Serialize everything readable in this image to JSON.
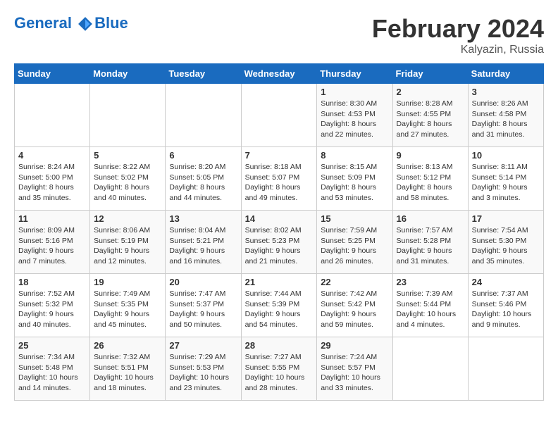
{
  "header": {
    "logo_line1": "General",
    "logo_line2": "Blue",
    "title": "February 2024",
    "subtitle": "Kalyazin, Russia"
  },
  "days_of_week": [
    "Sunday",
    "Monday",
    "Tuesday",
    "Wednesday",
    "Thursday",
    "Friday",
    "Saturday"
  ],
  "weeks": [
    [
      {
        "day": "",
        "info": ""
      },
      {
        "day": "",
        "info": ""
      },
      {
        "day": "",
        "info": ""
      },
      {
        "day": "",
        "info": ""
      },
      {
        "day": "1",
        "info": "Sunrise: 8:30 AM\nSunset: 4:53 PM\nDaylight: 8 hours\nand 22 minutes."
      },
      {
        "day": "2",
        "info": "Sunrise: 8:28 AM\nSunset: 4:55 PM\nDaylight: 8 hours\nand 27 minutes."
      },
      {
        "day": "3",
        "info": "Sunrise: 8:26 AM\nSunset: 4:58 PM\nDaylight: 8 hours\nand 31 minutes."
      }
    ],
    [
      {
        "day": "4",
        "info": "Sunrise: 8:24 AM\nSunset: 5:00 PM\nDaylight: 8 hours\nand 35 minutes."
      },
      {
        "day": "5",
        "info": "Sunrise: 8:22 AM\nSunset: 5:02 PM\nDaylight: 8 hours\nand 40 minutes."
      },
      {
        "day": "6",
        "info": "Sunrise: 8:20 AM\nSunset: 5:05 PM\nDaylight: 8 hours\nand 44 minutes."
      },
      {
        "day": "7",
        "info": "Sunrise: 8:18 AM\nSunset: 5:07 PM\nDaylight: 8 hours\nand 49 minutes."
      },
      {
        "day": "8",
        "info": "Sunrise: 8:15 AM\nSunset: 5:09 PM\nDaylight: 8 hours\nand 53 minutes."
      },
      {
        "day": "9",
        "info": "Sunrise: 8:13 AM\nSunset: 5:12 PM\nDaylight: 8 hours\nand 58 minutes."
      },
      {
        "day": "10",
        "info": "Sunrise: 8:11 AM\nSunset: 5:14 PM\nDaylight: 9 hours\nand 3 minutes."
      }
    ],
    [
      {
        "day": "11",
        "info": "Sunrise: 8:09 AM\nSunset: 5:16 PM\nDaylight: 9 hours\nand 7 minutes."
      },
      {
        "day": "12",
        "info": "Sunrise: 8:06 AM\nSunset: 5:19 PM\nDaylight: 9 hours\nand 12 minutes."
      },
      {
        "day": "13",
        "info": "Sunrise: 8:04 AM\nSunset: 5:21 PM\nDaylight: 9 hours\nand 16 minutes."
      },
      {
        "day": "14",
        "info": "Sunrise: 8:02 AM\nSunset: 5:23 PM\nDaylight: 9 hours\nand 21 minutes."
      },
      {
        "day": "15",
        "info": "Sunrise: 7:59 AM\nSunset: 5:25 PM\nDaylight: 9 hours\nand 26 minutes."
      },
      {
        "day": "16",
        "info": "Sunrise: 7:57 AM\nSunset: 5:28 PM\nDaylight: 9 hours\nand 31 minutes."
      },
      {
        "day": "17",
        "info": "Sunrise: 7:54 AM\nSunset: 5:30 PM\nDaylight: 9 hours\nand 35 minutes."
      }
    ],
    [
      {
        "day": "18",
        "info": "Sunrise: 7:52 AM\nSunset: 5:32 PM\nDaylight: 9 hours\nand 40 minutes."
      },
      {
        "day": "19",
        "info": "Sunrise: 7:49 AM\nSunset: 5:35 PM\nDaylight: 9 hours\nand 45 minutes."
      },
      {
        "day": "20",
        "info": "Sunrise: 7:47 AM\nSunset: 5:37 PM\nDaylight: 9 hours\nand 50 minutes."
      },
      {
        "day": "21",
        "info": "Sunrise: 7:44 AM\nSunset: 5:39 PM\nDaylight: 9 hours\nand 54 minutes."
      },
      {
        "day": "22",
        "info": "Sunrise: 7:42 AM\nSunset: 5:42 PM\nDaylight: 9 hours\nand 59 minutes."
      },
      {
        "day": "23",
        "info": "Sunrise: 7:39 AM\nSunset: 5:44 PM\nDaylight: 10 hours\nand 4 minutes."
      },
      {
        "day": "24",
        "info": "Sunrise: 7:37 AM\nSunset: 5:46 PM\nDaylight: 10 hours\nand 9 minutes."
      }
    ],
    [
      {
        "day": "25",
        "info": "Sunrise: 7:34 AM\nSunset: 5:48 PM\nDaylight: 10 hours\nand 14 minutes."
      },
      {
        "day": "26",
        "info": "Sunrise: 7:32 AM\nSunset: 5:51 PM\nDaylight: 10 hours\nand 18 minutes."
      },
      {
        "day": "27",
        "info": "Sunrise: 7:29 AM\nSunset: 5:53 PM\nDaylight: 10 hours\nand 23 minutes."
      },
      {
        "day": "28",
        "info": "Sunrise: 7:27 AM\nSunset: 5:55 PM\nDaylight: 10 hours\nand 28 minutes."
      },
      {
        "day": "29",
        "info": "Sunrise: 7:24 AM\nSunset: 5:57 PM\nDaylight: 10 hours\nand 33 minutes."
      },
      {
        "day": "",
        "info": ""
      },
      {
        "day": "",
        "info": ""
      }
    ]
  ]
}
